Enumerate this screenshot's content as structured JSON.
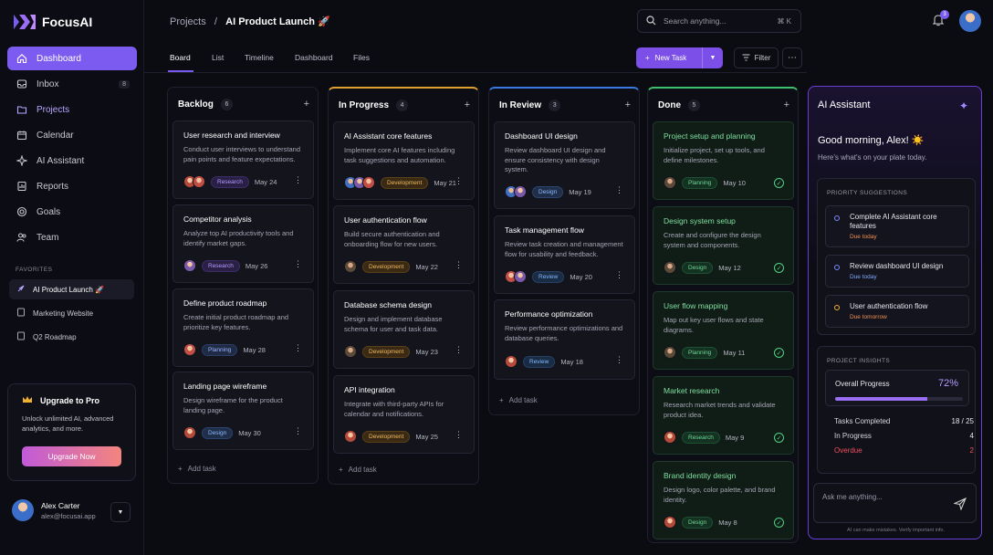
{
  "app": {
    "name": "FocusAI"
  },
  "sidebar": {
    "items": [
      {
        "label": "Dashboard",
        "icon": "home-icon"
      },
      {
        "label": "Inbox",
        "icon": "inbox-icon",
        "count": "8"
      },
      {
        "label": "Projects",
        "icon": "folder-icon"
      },
      {
        "label": "Calendar",
        "icon": "calendar-icon"
      },
      {
        "label": "AI Assistant",
        "icon": "sparkle-icon"
      },
      {
        "label": "Reports",
        "icon": "reports-icon"
      },
      {
        "label": "Goals",
        "icon": "target-icon"
      },
      {
        "label": "Team",
        "icon": "team-icon"
      }
    ],
    "favorites_label": "FAVORITES",
    "favorites": [
      {
        "label": "AI Product Launch 🚀"
      },
      {
        "label": "Marketing Website"
      },
      {
        "label": "Q2 Roadmap"
      }
    ],
    "upgrade": {
      "title": "Upgrade to Pro",
      "desc": "Unlock unlimited AI, advanced analytics, and more.",
      "button": "Upgrade Now"
    },
    "user": {
      "name": "Alex Carter",
      "email": "alex@focusai.app"
    }
  },
  "header": {
    "breadcrumb_root": "Projects",
    "breadcrumb_sep": "/",
    "breadcrumb_current": "AI Product Launch 🚀",
    "search_placeholder": "Search anything...",
    "search_shortcut": "⌘ K",
    "notif_count": "3"
  },
  "tabs": [
    {
      "label": "Board"
    },
    {
      "label": "List"
    },
    {
      "label": "Timeline"
    },
    {
      "label": "Dashboard"
    },
    {
      "label": "Files"
    }
  ],
  "toolbar": {
    "new_task": "New Task",
    "filter": "Filter"
  },
  "columns": [
    {
      "title": "Backlog",
      "count": "6",
      "accent": "#2a2a3a",
      "cards": [
        {
          "title": "User research and interview",
          "desc": "Conduct user interviews to understand pain points and feature expectations.",
          "tag": "Research",
          "date": "May 24"
        },
        {
          "title": "Competitor analysis",
          "desc": "Analyze top AI productivity tools and identify market gaps.",
          "tag": "Research",
          "date": "May 26"
        },
        {
          "title": "Define product roadmap",
          "desc": "Create initial product roadmap and prioritize key features.",
          "tag": "Planning",
          "date": "May 28"
        },
        {
          "title": "Landing page wireframe",
          "desc": "Design wireframe for the product landing page.",
          "tag": "Design",
          "date": "May 30"
        }
      ],
      "add": "Add task"
    },
    {
      "title": "In Progress",
      "count": "4",
      "accent": "#e0a030",
      "cards": [
        {
          "title": "AI Assistant core features",
          "desc": "Implement core AI features including task suggestions and automation.",
          "tag": "Development",
          "date": "May 21"
        },
        {
          "title": "User authentication flow",
          "desc": "Build secure authentication and onboarding flow for new users.",
          "tag": "Development",
          "date": "May 22"
        },
        {
          "title": "Database schema design",
          "desc": "Design and implement database schema for user and task data.",
          "tag": "Development",
          "date": "May 23"
        },
        {
          "title": "API integration",
          "desc": "Integrate with third-party APIs for calendar and notifications.",
          "tag": "Development",
          "date": "May 25"
        }
      ],
      "add": "Add task"
    },
    {
      "title": "In Review",
      "count": "3",
      "accent": "#3a7ae0",
      "cards": [
        {
          "title": "Dashboard UI design",
          "desc": "Review dashboard UI design and ensure consistency with design system.",
          "tag": "Design",
          "date": "May 19"
        },
        {
          "title": "Task management flow",
          "desc": "Review task creation and management flow for usability and feedback.",
          "tag": "Review",
          "date": "May 20"
        },
        {
          "title": "Performance optimization",
          "desc": "Review performance optimizations and database queries.",
          "tag": "Review",
          "date": "May 18"
        }
      ],
      "add": "Add task"
    },
    {
      "title": "Done",
      "count": "5",
      "accent": "#3cc070",
      "cards": [
        {
          "title": "Project setup and planning",
          "desc": "Initialize project, set up tools, and define milestones.",
          "tag": "Planning",
          "date": "May 10"
        },
        {
          "title": "Design system setup",
          "desc": "Create and configure the design system and components.",
          "tag": "Design",
          "date": "May 12"
        },
        {
          "title": "User flow mapping",
          "desc": "Map out key user flows and state diagrams.",
          "tag": "Planning",
          "date": "May 11"
        },
        {
          "title": "Market research",
          "desc": "Research market trends and validate product idea.",
          "tag": "Research",
          "date": "May 9"
        },
        {
          "title": "Brand identity design",
          "desc": "Design logo, color palette, and brand identity.",
          "tag": "Design",
          "date": "May 8"
        }
      ]
    }
  ],
  "ai": {
    "title": "AI Assistant",
    "greeting": "Good morning, Alex! ☀️",
    "sub": "Here's what's on your plate today.",
    "suggest_header": "PRIORITY SUGGESTIONS",
    "suggestions": [
      {
        "title": "Complete AI Assistant core features",
        "due": "Due today"
      },
      {
        "title": "Review dashboard UI design",
        "due": "Due today"
      },
      {
        "title": "User authentication flow",
        "due": "Due tomorrow"
      }
    ],
    "insights_header": "PROJECT INSIGHTS",
    "overall_label": "Overall Progress",
    "overall_value": "72%",
    "overall_fraction": 0.72,
    "stats": [
      {
        "label": "Tasks Completed",
        "value": "18 / 25"
      },
      {
        "label": "In Progress",
        "value": "4"
      },
      {
        "label": "Overdue",
        "value": "2"
      }
    ],
    "ask_placeholder": "Ask me anything...",
    "disclaimer": "AI can make mistakes. Verify important info."
  }
}
